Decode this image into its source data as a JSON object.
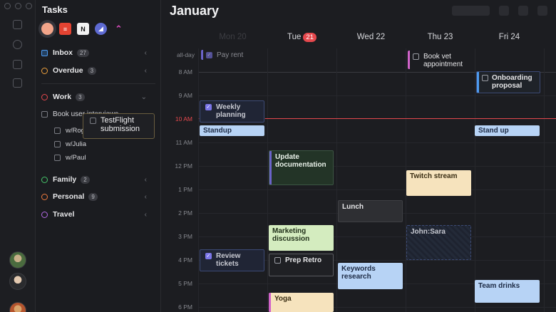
{
  "sidebar": {
    "title": "Tasks",
    "apps": [
      {
        "name": "circle-app-icon",
        "color": "#f2a58a",
        "glyph": ""
      },
      {
        "name": "todoist-app-icon",
        "color": "#e44332",
        "glyph": "≡"
      },
      {
        "name": "notion-app-icon",
        "color": "#f2f2f2",
        "glyph": "N"
      },
      {
        "name": "linear-app-icon",
        "color": "#5e6ad2",
        "glyph": "◢"
      },
      {
        "name": "clickup-app-icon",
        "color": "#b94fd8",
        "glyph": "⌃"
      }
    ],
    "inbox": {
      "label": "Inbox",
      "count": "27",
      "color": "#4d9bf0"
    },
    "overdue": {
      "label": "Overdue",
      "count": "3",
      "color": "#f0a23d"
    },
    "work": {
      "label": "Work",
      "count": "3",
      "color": "#e5484d"
    },
    "work_items": {
      "task": "Book user interviews",
      "subs": [
        "w/Roger",
        "w/Julia",
        "w/Paul"
      ]
    },
    "family": {
      "label": "Family",
      "count": "2",
      "color": "#46c46a"
    },
    "personal": {
      "label": "Personal",
      "count": "9",
      "color": "#f07a3d"
    },
    "travel": {
      "label": "Travel",
      "count": "",
      "color": "#b46ae5"
    },
    "drag_card": "TestFlight submission"
  },
  "calendar": {
    "month": "January",
    "days": [
      {
        "label": "Mon 20",
        "num": ""
      },
      {
        "label": "Tue",
        "num": "21"
      },
      {
        "label": "Wed 22",
        "num": ""
      },
      {
        "label": "Thu 23",
        "num": ""
      },
      {
        "label": "Fri 24",
        "num": ""
      }
    ],
    "allday_label": "all-day",
    "hours": [
      "8 AM",
      "9 AM",
      "10 AM",
      "11 AM",
      "12 PM",
      "1 PM",
      "2 PM",
      "3 PM",
      "4 PM",
      "5 PM",
      "6 PM"
    ],
    "events": {
      "pay_rent": "Pay rent",
      "book_vet": "Book vet appointment",
      "onboarding": "Onboarding proposal",
      "weekly_planning": "Weekly planning",
      "standup": "Standup",
      "stand_up_fri": "Stand up",
      "update_docs": "Update documentation",
      "twitch": "Twitch stream",
      "lunch": "Lunch",
      "marketing": "Marketing discussion",
      "john_sara": "John:Sara",
      "review_tickets": "Review tickets",
      "prep_retro": "Prep Retro",
      "keywords": "Keywords research",
      "team_drinks": "Team drinks",
      "yoga": "Yoga"
    }
  }
}
